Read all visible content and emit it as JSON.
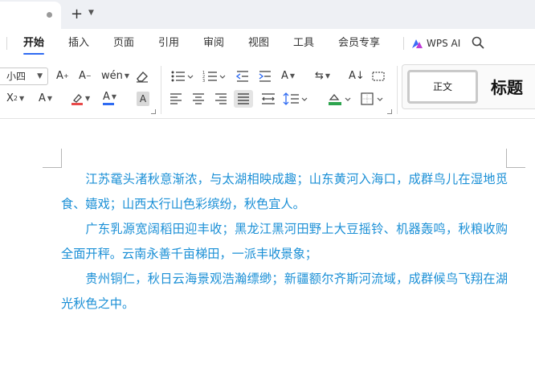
{
  "menu": {
    "items": [
      "开始",
      "插入",
      "页面",
      "引用",
      "审阅",
      "视图",
      "工具",
      "会员专享"
    ],
    "wps_ai": "WPS AI"
  },
  "toolbar": {
    "font_size": "小四",
    "style_normal": "正文",
    "style_heading": "标题"
  },
  "document": {
    "paragraphs": [
      "江苏鼋头渚秋意渐浓，与太湖相映成趣；山东黄河入海口，成群鸟儿在湿地觅食、嬉戏；山西太行山色彩缤纷，秋色宜人。",
      "广东乳源宽阔稻田迎丰收；黑龙江黑河田野上大豆摇铃、机器轰鸣，秋粮收购全面开秤。云南永善千亩梯田，一派丰收景象；",
      "贵州铜仁，秋日云海景观浩瀚缥缈；新疆额尔齐斯河流域，成群候鸟飞翔在湖光秋色之中。"
    ]
  },
  "colors": {
    "accent": "#2f6bf2",
    "text_blue": "#1a8fd6"
  }
}
